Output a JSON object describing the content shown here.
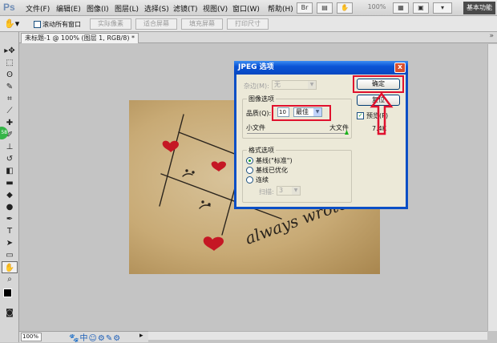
{
  "app": {
    "logo": "Ps",
    "workspace_button": "基本功能"
  },
  "menubar": {
    "items": [
      "文件(F)",
      "编辑(E)",
      "图像(I)",
      "图层(L)",
      "选择(S)",
      "滤镜(T)",
      "视图(V)",
      "窗口(W)",
      "帮助(H)"
    ],
    "zoom": "100%"
  },
  "options_bar": {
    "checkbox_label": "滚动所有窗口",
    "buttons": [
      "实际像素",
      "适合屏幕",
      "填充屏幕",
      "打印尺寸"
    ]
  },
  "document": {
    "tab_title": "未标题-1 @ 100% (图层 1, RGB/8) *"
  },
  "statusbar": {
    "zoom": "100%"
  },
  "photo": {
    "text": "always wrote"
  },
  "dialog": {
    "title": "JPEG 选项",
    "close": "x",
    "matte_label": "杂边(M):",
    "matte_value": "无",
    "image_options_title": "图像选项",
    "quality_label": "品质(Q):",
    "quality_value": "最佳",
    "small_file": "小文件",
    "large_file": "大文件",
    "format_title": "格式选项",
    "format_options": [
      "基线(\"标准\")",
      "基线已优化",
      "连续"
    ],
    "scans_label": "扫描:",
    "scans_value": "3",
    "ok_button": "确定",
    "cancel_button": "复位",
    "preview_label": "预览(P)",
    "size_text": "7.4K"
  },
  "colors": {
    "accent_red": "#e0112e",
    "dialog_title": "#0a54d6"
  }
}
